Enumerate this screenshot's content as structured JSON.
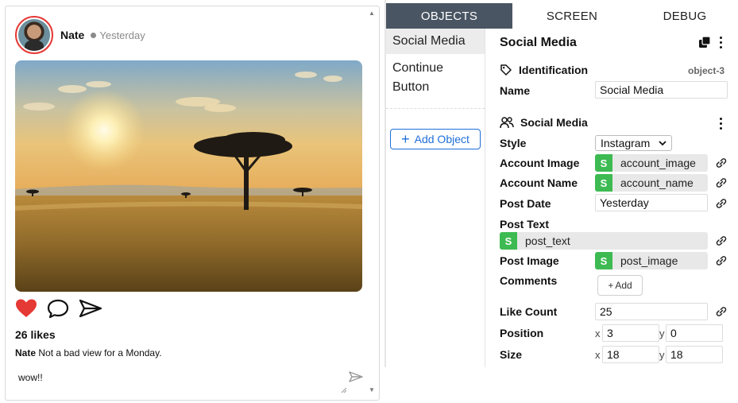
{
  "post": {
    "account_name": "Nate",
    "date": "Yesterday",
    "likes": "26 likes",
    "caption_user": "Nate",
    "caption_text": "Not a bad view for a Monday.",
    "comment": "wow!!"
  },
  "tabs": [
    {
      "label": "OBJECTS",
      "active": true
    },
    {
      "label": "SCREEN",
      "active": false
    },
    {
      "label": "DEBUG",
      "active": false
    }
  ],
  "objects": {
    "items": [
      "Social Media",
      "Continue Button"
    ],
    "add_label": "Add Object"
  },
  "properties": {
    "title": "Social Media",
    "identification_label": "Identification",
    "object_id": "object-3",
    "name_label": "Name",
    "name_value": "Social Media",
    "section_label": "Social Media",
    "style_label": "Style",
    "style_value": "Instagram",
    "account_image_label": "Account Image",
    "account_image_binding": "account_image",
    "account_name_label": "Account Name",
    "account_name_binding": "account_name",
    "post_date_label": "Post Date",
    "post_date_value": "Yesterday",
    "post_text_label": "Post Text",
    "post_text_binding": "post_text",
    "post_image_label": "Post Image",
    "post_image_binding": "post_image",
    "comments_label": "Comments",
    "comments_add": "Add",
    "like_count_label": "Like Count",
    "like_count_value": "25",
    "position_label": "Position",
    "position_x": "3",
    "position_y": "0",
    "size_label": "Size",
    "size_x": "18",
    "size_y": "18",
    "x_label": "x",
    "y_label": "y",
    "binding_badge": "S"
  },
  "colors": {
    "accent": "#1e6fd9",
    "tab_active": "#4a5563",
    "binding_badge": "#3dbb52",
    "like_heart": "#e53935"
  }
}
